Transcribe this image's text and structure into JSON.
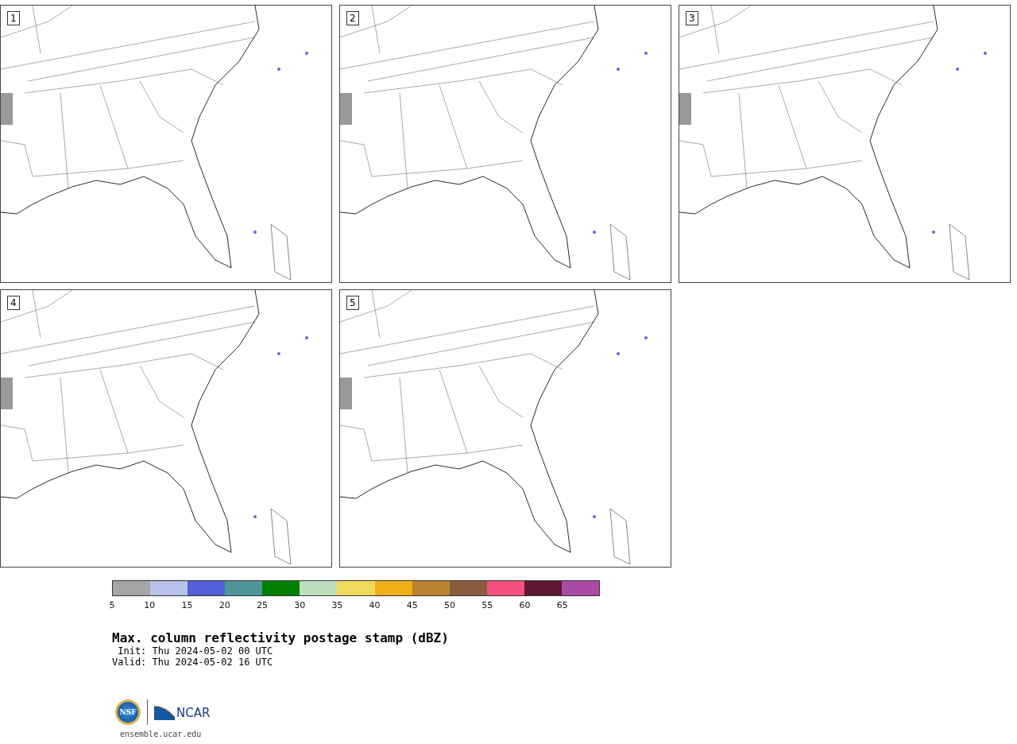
{
  "panels": [
    {
      "number": "1"
    },
    {
      "number": "2"
    },
    {
      "number": "3"
    },
    {
      "number": "4"
    },
    {
      "number": "5"
    }
  ],
  "colorbar": {
    "bins": [
      {
        "color": "#a5a5a5"
      },
      {
        "color": "#b7c2ec"
      },
      {
        "color": "#525fd6"
      },
      {
        "color": "#4e9599"
      },
      {
        "color": "#018001"
      },
      {
        "color": "#bedfbf"
      },
      {
        "color": "#f0da5d"
      },
      {
        "color": "#f0ae17"
      },
      {
        "color": "#ba8231"
      },
      {
        "color": "#8b5b40"
      },
      {
        "color": "#f5507d"
      },
      {
        "color": "#5f1733"
      },
      {
        "color": "#ac4ba4"
      }
    ],
    "tick_labels": [
      "5",
      "10",
      "15",
      "20",
      "25",
      "30",
      "35",
      "40",
      "45",
      "50",
      "55",
      "60",
      "65"
    ]
  },
  "caption": {
    "title": "Max. column reflectivity postage stamp (dBZ)",
    "init": " Init: Thu 2024-05-02 00 UTC",
    "valid": "Valid: Thu 2024-05-02 16 UTC"
  },
  "footer": {
    "logo_left": "NSF",
    "logo_right": "NCAR",
    "url": "ensemble.ucar.edu"
  }
}
